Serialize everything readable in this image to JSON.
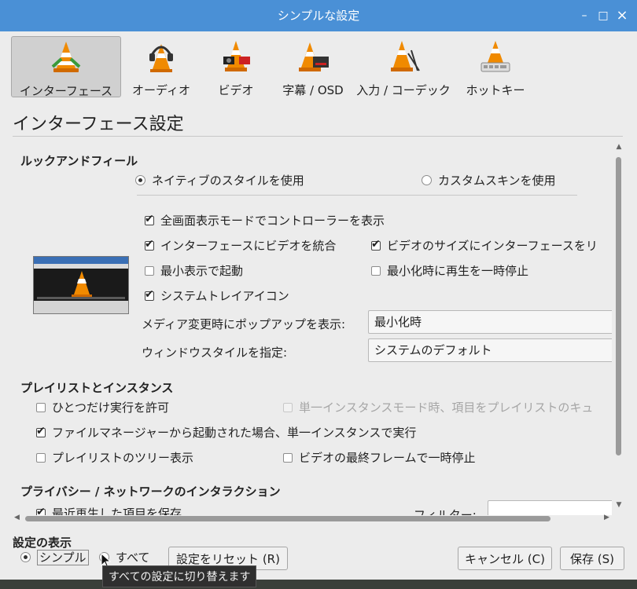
{
  "window": {
    "title": "シンプルな設定",
    "min_label": "–",
    "max_label": "□",
    "close_label": "×"
  },
  "toolbar": {
    "items": [
      {
        "label": "インターフェース",
        "icon": "interface-cone-icon",
        "active": true
      },
      {
        "label": "オーディオ",
        "icon": "audio-headphones-cone-icon"
      },
      {
        "label": "ビデオ",
        "icon": "video-cone-icon"
      },
      {
        "label": "字幕 / OSD",
        "icon": "subtitles-cone-icon"
      },
      {
        "label": "入力 / コーデック",
        "icon": "input-codec-cone-icon"
      },
      {
        "label": "ホットキー",
        "icon": "hotkeys-cone-icon"
      }
    ]
  },
  "page_title": "インターフェース設定",
  "look_and_feel": {
    "heading": "ルックアンドフィール",
    "native_style": "ネイティブのスタイルを使用",
    "custom_skin": "カスタムスキンを使用",
    "fullscreen_controller": "全画面表示モードでコントローラーを表示",
    "embed_video": "インターフェースにビデオを統合",
    "resize_to_video": "ビデオのサイズにインターフェースをリ",
    "start_minimal": "最小表示で起動",
    "pause_minimized": "最小化時に再生を一時停止",
    "systray": "システムトレイアイコン",
    "popup_label": "メディア変更時にポップアップを表示:",
    "popup_value": "最小化時",
    "window_style_label": "ウィンドウスタイルを指定:",
    "window_style_value": "システムのデフォルト"
  },
  "playlist": {
    "heading": "プレイリストとインスタンス",
    "one_instance": "ひとつだけ実行を許可",
    "enqueue_single": "単一インスタンスモード時、項目をプレイリストのキュ",
    "file_manager_instance": "ファイルマネージャーから起動された場合、単一インスタンスで実行",
    "tree_view": "プレイリストのツリー表示",
    "pause_last_frame": "ビデオの最終フレームで一時停止"
  },
  "privacy": {
    "heading": "プライバシー / ネットワークのインタラクション",
    "save_recent": "最近再生した項目を保存",
    "filter_label": "フィルター:",
    "filter_value": ""
  },
  "footer": {
    "show_settings": "設定の表示",
    "simple": "シンプル",
    "all": "すべて",
    "reset": "設定をリセット (R)",
    "cancel": "キャンセル (C)",
    "save": "保存 (S)",
    "tooltip": "すべての設定に切り替えます"
  }
}
